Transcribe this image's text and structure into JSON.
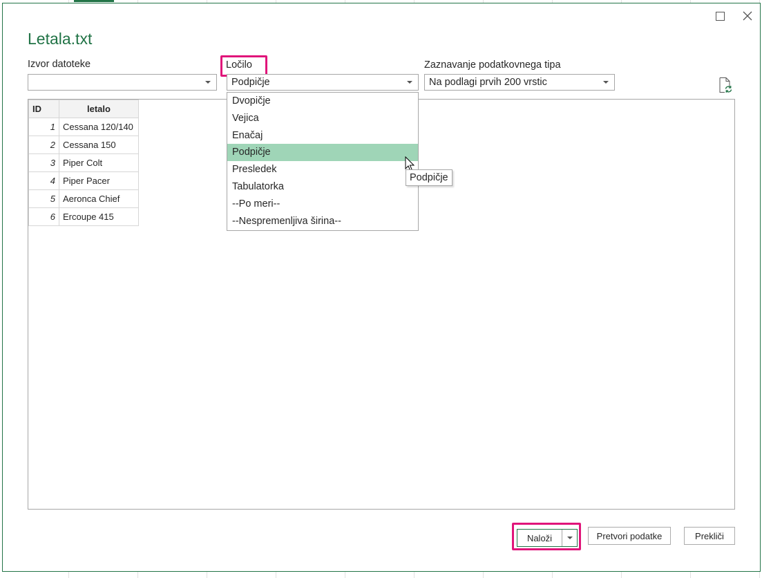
{
  "dialog": {
    "title": "Letala.txt"
  },
  "source": {
    "label": "Izvor datoteke",
    "value": ""
  },
  "delimiter": {
    "label": "Ločilo",
    "value": "Podpičje",
    "options": [
      "Dvopičje",
      "Vejica",
      "Enačaj",
      "Podpičje",
      "Presledek",
      "Tabulatorka",
      "--Po meri--",
      "--Nespremenljiva širina--"
    ],
    "selected_index": 3,
    "tooltip": "Podpičje"
  },
  "type_detection": {
    "label": "Zaznavanje podatkovnega tipa",
    "value": "Na podlagi prvih 200 vrstic"
  },
  "preview": {
    "columns": [
      "ID",
      "letalo"
    ],
    "rows": [
      [
        "1",
        "Cessana 120/140"
      ],
      [
        "2",
        "Cessana 150"
      ],
      [
        "3",
        "Piper Colt"
      ],
      [
        "4",
        "Piper Pacer"
      ],
      [
        "5",
        "Aeronca Chief"
      ],
      [
        "6",
        "Ercoupe 415"
      ]
    ]
  },
  "buttons": {
    "load": "Naloži",
    "transform": "Pretvori podatke",
    "cancel": "Prekliči"
  },
  "colors": {
    "accent": "#217346",
    "highlight": "#e0157a",
    "selected_item": "#9fd5b7"
  }
}
